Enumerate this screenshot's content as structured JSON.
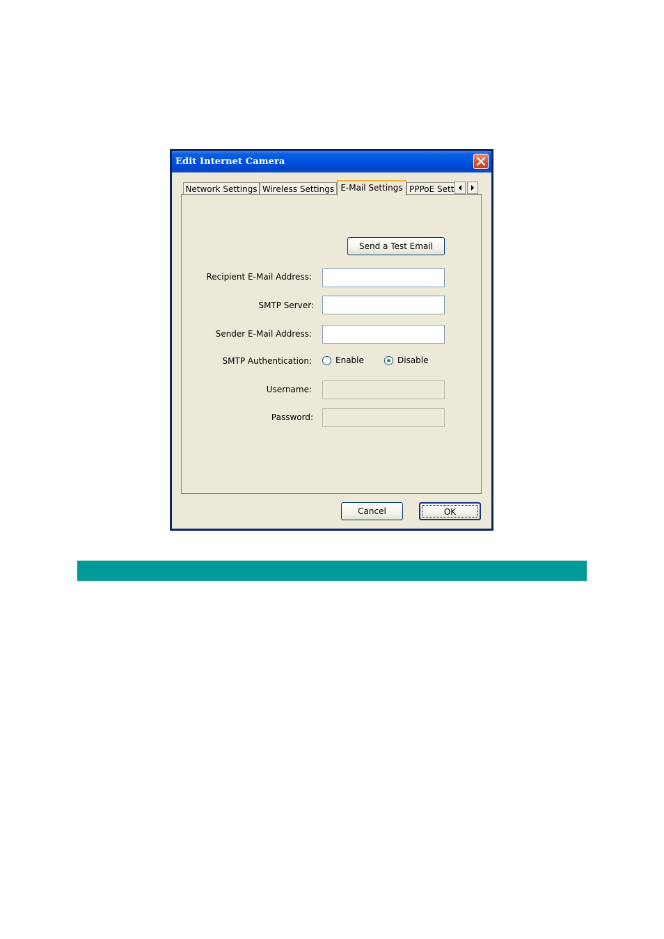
{
  "window": {
    "title": "Edit Internet Camera"
  },
  "tabs": [
    {
      "label": "Network Settings",
      "active": false
    },
    {
      "label": "Wireless Settings",
      "active": false
    },
    {
      "label": "E-Mail Settings",
      "active": true
    },
    {
      "label": "PPPoE Setti",
      "active": false
    }
  ],
  "tab_scroll": {
    "left_icon": "arrow-left-icon",
    "right_icon": "arrow-right-icon"
  },
  "email": {
    "test_button": "Send a Test Email",
    "recipient_label": "Recipient E-Mail Address:",
    "recipient_value": "",
    "smtp_server_label": "SMTP Server:",
    "smtp_server_value": "",
    "sender_label": "Sender E-Mail Address:",
    "sender_value": "",
    "auth_label": "SMTP Authentication:",
    "auth_enable": "Enable",
    "auth_disable": "Disable",
    "auth_selected": "Disable",
    "username_label": "Username:",
    "username_value": "",
    "password_label": "Password:",
    "password_value": ""
  },
  "footer": {
    "cancel_label": "Cancel",
    "ok_label": "OK"
  },
  "colors": {
    "banner": "#009b96",
    "titlebar": "#0053e1",
    "dialog_bg": "#ece9d8"
  }
}
